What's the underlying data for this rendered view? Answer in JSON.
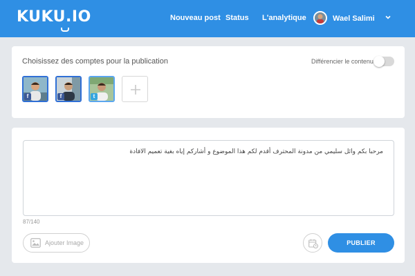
{
  "header": {
    "logo": "KUKU.IO",
    "nav": [
      "Nouveau post",
      "Status",
      "L'analytique"
    ],
    "user_name": "Wael Salimi"
  },
  "accounts_section": {
    "title": "Choisissez des comptes pour la publication",
    "differentiate_label": "Différencier le contenu",
    "differentiate_enabled": false,
    "accounts": [
      {
        "network": "facebook",
        "badge": "f",
        "selected": false
      },
      {
        "network": "facebook",
        "badge": "f",
        "selected": false
      },
      {
        "network": "twitter",
        "badge": "t",
        "selected": true
      }
    ]
  },
  "composer": {
    "text": "مرحبا بكم وائل سليمي من مدونة المحترف أقدم لكم هذا الموضوع و أشاركم إياه بغية تعميم الافادة",
    "counter": "87/140",
    "add_image_label": "Ajouter Image",
    "publish_label": "PUBLIER"
  },
  "colors": {
    "brand": "#2f8fe4",
    "background": "#e5e8ec",
    "facebook": "#3b5998",
    "twitter": "#35a6df"
  },
  "icons": [
    "logo-icon",
    "chevron-down-icon",
    "plus-icon",
    "image-icon",
    "calendar-clock-icon"
  ]
}
